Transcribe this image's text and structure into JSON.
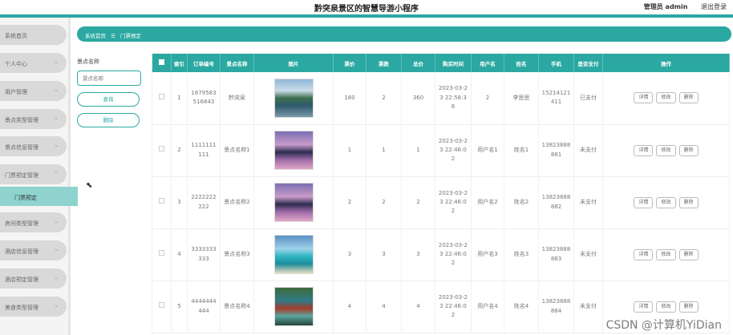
{
  "header": {
    "title": "黔突泉景区的智慧导游小程序",
    "user": "管理员 admin",
    "logout": "退出登录"
  },
  "sidebar": {
    "items": [
      {
        "label": "系统首页",
        "chev": false
      },
      {
        "label": "个人中心",
        "chev": true
      },
      {
        "label": "用户管理",
        "chev": true
      },
      {
        "label": "景点类型管理",
        "chev": true
      },
      {
        "label": "景点信息管理",
        "chev": true
      },
      {
        "label": "门票预定管理",
        "chev": true,
        "open": true
      },
      {
        "label": "房间类型管理",
        "chev": true
      },
      {
        "label": "酒店信息管理",
        "chev": true
      },
      {
        "label": "酒店预定管理",
        "chev": true
      },
      {
        "label": "美食类型管理",
        "chev": true
      }
    ],
    "active_sub": "门票预定"
  },
  "breadcrumb": {
    "home": "系统首页",
    "sep": "☰",
    "current": "门票预定"
  },
  "search": {
    "label": "景点名称",
    "placeholder": "景点名称",
    "query_btn": "查询",
    "delete_btn": "删除"
  },
  "table": {
    "headers": [
      "",
      "索引",
      "订单编号",
      "景点名称",
      "图片",
      "票价",
      "票数",
      "总价",
      "购买时间",
      "用户名",
      "姓名",
      "手机",
      "是否支付",
      "操作"
    ],
    "actions": [
      "详情",
      "修改",
      "删除"
    ],
    "rows": [
      {
        "index": "1",
        "order": "1679583516843",
        "spot": "黔突泉",
        "price": "180",
        "count": "2",
        "total": "360",
        "time": "2023-03-23 22:58:36",
        "username": "2",
        "name": "李思思",
        "phone": "15214121411",
        "paid": "已支付",
        "img": "lake"
      },
      {
        "index": "2",
        "order": "1111111111",
        "spot": "景点名称1",
        "price": "1",
        "count": "1",
        "total": "1",
        "time": "2023-03-23 22:46:02",
        "username": "用户名1",
        "name": "姓名1",
        "phone": "13823888881",
        "paid": "未支付",
        "img": "dusk"
      },
      {
        "index": "3",
        "order": "2222222222",
        "spot": "景点名称2",
        "price": "2",
        "count": "2",
        "total": "2",
        "time": "2023-03-23 22:46:02",
        "username": "用户名2",
        "name": "姓名2",
        "phone": "13823888882",
        "paid": "未支付",
        "img": "dusk"
      },
      {
        "index": "4",
        "order": "3333333333",
        "spot": "景点名称3",
        "price": "3",
        "count": "3",
        "total": "3",
        "time": "2023-03-23 22:46:02",
        "username": "用户名3",
        "name": "姓名3",
        "phone": "13823888883",
        "paid": "未支付",
        "img": "beach"
      },
      {
        "index": "5",
        "order": "4444444444",
        "spot": "景点名称4",
        "price": "4",
        "count": "4",
        "total": "4",
        "time": "2023-03-23 22:46:02",
        "username": "用户名4",
        "name": "姓名4",
        "phone": "13823888884",
        "paid": "未支付",
        "img": "waterfall"
      }
    ]
  },
  "watermark": "CSDN @计算机YiDian"
}
